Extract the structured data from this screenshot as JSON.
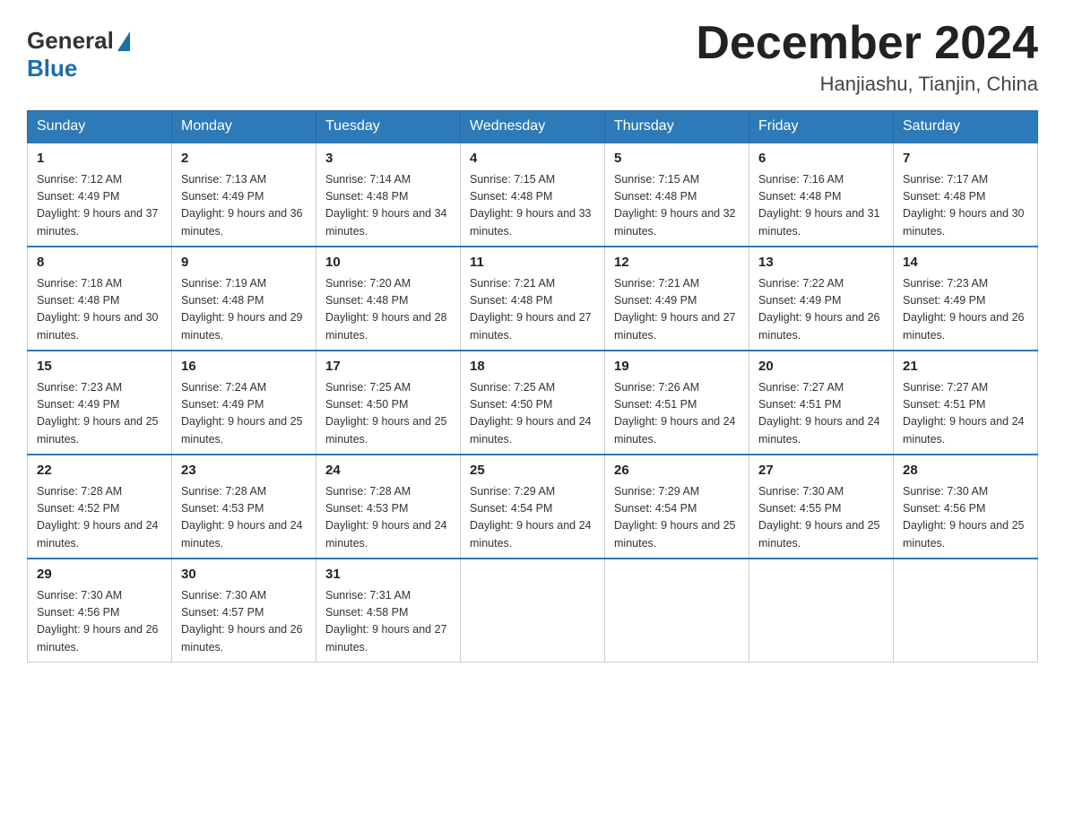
{
  "header": {
    "logo_general": "General",
    "logo_blue": "Blue",
    "month_title": "December 2024",
    "subtitle": "Hanjiashu, Tianjin, China"
  },
  "weekdays": [
    "Sunday",
    "Monday",
    "Tuesday",
    "Wednesday",
    "Thursday",
    "Friday",
    "Saturday"
  ],
  "weeks": [
    [
      {
        "day": "1",
        "sunrise": "7:12 AM",
        "sunset": "4:49 PM",
        "daylight": "9 hours and 37 minutes."
      },
      {
        "day": "2",
        "sunrise": "7:13 AM",
        "sunset": "4:49 PM",
        "daylight": "9 hours and 36 minutes."
      },
      {
        "day": "3",
        "sunrise": "7:14 AM",
        "sunset": "4:48 PM",
        "daylight": "9 hours and 34 minutes."
      },
      {
        "day": "4",
        "sunrise": "7:15 AM",
        "sunset": "4:48 PM",
        "daylight": "9 hours and 33 minutes."
      },
      {
        "day": "5",
        "sunrise": "7:15 AM",
        "sunset": "4:48 PM",
        "daylight": "9 hours and 32 minutes."
      },
      {
        "day": "6",
        "sunrise": "7:16 AM",
        "sunset": "4:48 PM",
        "daylight": "9 hours and 31 minutes."
      },
      {
        "day": "7",
        "sunrise": "7:17 AM",
        "sunset": "4:48 PM",
        "daylight": "9 hours and 30 minutes."
      }
    ],
    [
      {
        "day": "8",
        "sunrise": "7:18 AM",
        "sunset": "4:48 PM",
        "daylight": "9 hours and 30 minutes."
      },
      {
        "day": "9",
        "sunrise": "7:19 AM",
        "sunset": "4:48 PM",
        "daylight": "9 hours and 29 minutes."
      },
      {
        "day": "10",
        "sunrise": "7:20 AM",
        "sunset": "4:48 PM",
        "daylight": "9 hours and 28 minutes."
      },
      {
        "day": "11",
        "sunrise": "7:21 AM",
        "sunset": "4:48 PM",
        "daylight": "9 hours and 27 minutes."
      },
      {
        "day": "12",
        "sunrise": "7:21 AM",
        "sunset": "4:49 PM",
        "daylight": "9 hours and 27 minutes."
      },
      {
        "day": "13",
        "sunrise": "7:22 AM",
        "sunset": "4:49 PM",
        "daylight": "9 hours and 26 minutes."
      },
      {
        "day": "14",
        "sunrise": "7:23 AM",
        "sunset": "4:49 PM",
        "daylight": "9 hours and 26 minutes."
      }
    ],
    [
      {
        "day": "15",
        "sunrise": "7:23 AM",
        "sunset": "4:49 PM",
        "daylight": "9 hours and 25 minutes."
      },
      {
        "day": "16",
        "sunrise": "7:24 AM",
        "sunset": "4:49 PM",
        "daylight": "9 hours and 25 minutes."
      },
      {
        "day": "17",
        "sunrise": "7:25 AM",
        "sunset": "4:50 PM",
        "daylight": "9 hours and 25 minutes."
      },
      {
        "day": "18",
        "sunrise": "7:25 AM",
        "sunset": "4:50 PM",
        "daylight": "9 hours and 24 minutes."
      },
      {
        "day": "19",
        "sunrise": "7:26 AM",
        "sunset": "4:51 PM",
        "daylight": "9 hours and 24 minutes."
      },
      {
        "day": "20",
        "sunrise": "7:27 AM",
        "sunset": "4:51 PM",
        "daylight": "9 hours and 24 minutes."
      },
      {
        "day": "21",
        "sunrise": "7:27 AM",
        "sunset": "4:51 PM",
        "daylight": "9 hours and 24 minutes."
      }
    ],
    [
      {
        "day": "22",
        "sunrise": "7:28 AM",
        "sunset": "4:52 PM",
        "daylight": "9 hours and 24 minutes."
      },
      {
        "day": "23",
        "sunrise": "7:28 AM",
        "sunset": "4:53 PM",
        "daylight": "9 hours and 24 minutes."
      },
      {
        "day": "24",
        "sunrise": "7:28 AM",
        "sunset": "4:53 PM",
        "daylight": "9 hours and 24 minutes."
      },
      {
        "day": "25",
        "sunrise": "7:29 AM",
        "sunset": "4:54 PM",
        "daylight": "9 hours and 24 minutes."
      },
      {
        "day": "26",
        "sunrise": "7:29 AM",
        "sunset": "4:54 PM",
        "daylight": "9 hours and 25 minutes."
      },
      {
        "day": "27",
        "sunrise": "7:30 AM",
        "sunset": "4:55 PM",
        "daylight": "9 hours and 25 minutes."
      },
      {
        "day": "28",
        "sunrise": "7:30 AM",
        "sunset": "4:56 PM",
        "daylight": "9 hours and 25 minutes."
      }
    ],
    [
      {
        "day": "29",
        "sunrise": "7:30 AM",
        "sunset": "4:56 PM",
        "daylight": "9 hours and 26 minutes."
      },
      {
        "day": "30",
        "sunrise": "7:30 AM",
        "sunset": "4:57 PM",
        "daylight": "9 hours and 26 minutes."
      },
      {
        "day": "31",
        "sunrise": "7:31 AM",
        "sunset": "4:58 PM",
        "daylight": "9 hours and 27 minutes."
      },
      null,
      null,
      null,
      null
    ]
  ]
}
